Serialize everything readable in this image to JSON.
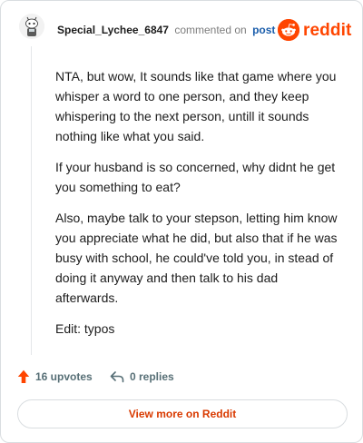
{
  "comment": {
    "username": "Special_Lychee_6847",
    "action_text": "commented on",
    "link_text": "post",
    "paragraphs": [
      "NTA, but wow, It sounds like that game where you whisper a word to one person, and they keep whispering to the next person, untill it sounds nothing like what you said.",
      "If your husband is so concerned, why didnt he get you something to eat?",
      "Also, maybe talk to your stepson, letting him know you appreciate what he did, but also that if he was busy with school, he could've told you, in stead of doing it anyway and then talk to his dad afterwards.",
      "Edit: typos"
    ]
  },
  "brand": {
    "wordmark": "reddit",
    "color": "#ff4500",
    "icon": "reddit-logo-icon"
  },
  "actions": {
    "upvotes_label": "16 upvotes",
    "replies_label": "0 replies",
    "upvote_icon": "upvote-arrow-icon",
    "reply_icon": "reply-arrow-icon",
    "upvote_color": "#ff4500"
  },
  "footer": {
    "view_more_label": "View more on Reddit",
    "link_color": "#d93a00"
  }
}
